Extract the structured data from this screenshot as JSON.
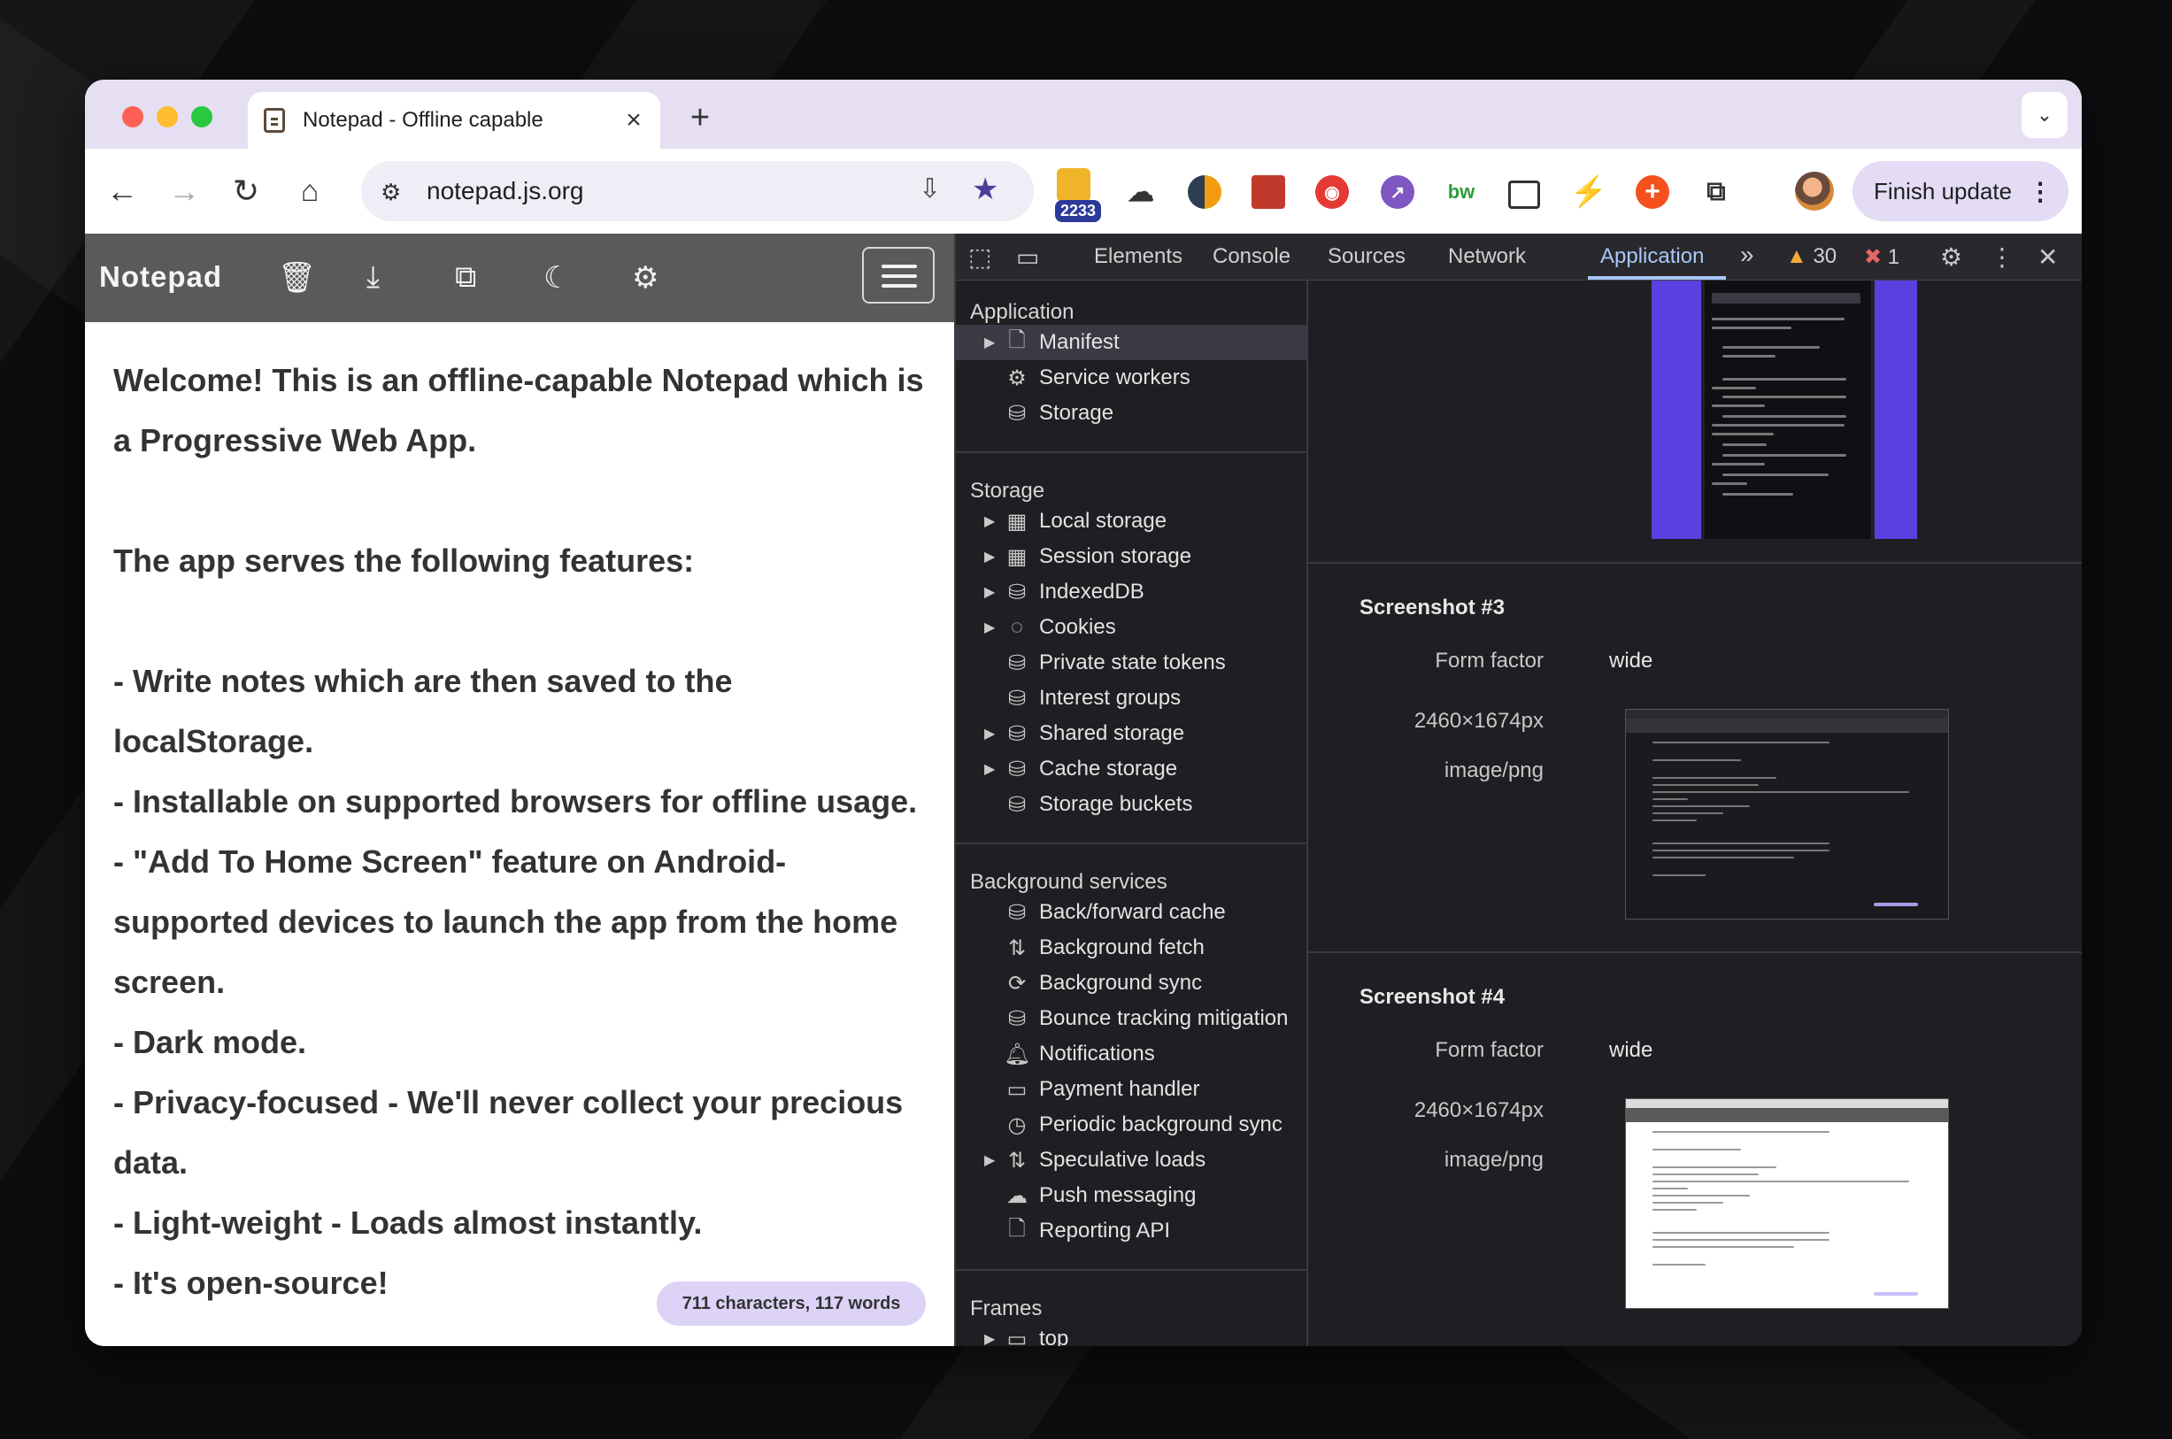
{
  "browser": {
    "tab_title": "Notepad - Offline capable",
    "url": "notepad.js.org",
    "extension_badge": "2233",
    "finish_update_label": "Finish update"
  },
  "app": {
    "brand": "Notepad",
    "note_text": "Welcome! This is an offline-capable Notepad which is a Progressive Web App.\n\nThe app serves the following features:\n\n- Write notes which are then saved to the localStorage.\n- Installable on supported browsers for offline usage.\n- \"Add To Home Screen\" feature on Android-supported devices to launch the app from the home screen.\n- Dark mode.\n- Privacy-focused - We'll never collect your precious data.\n- Light-weight - Loads almost instantly.\n- It's open-source!",
    "counter": "711 characters, 117 words"
  },
  "devtools": {
    "tabs": [
      "Elements",
      "Console",
      "Sources",
      "Network",
      "Application"
    ],
    "active_tab": "Application",
    "warnings": "30",
    "errors": "1",
    "sections": {
      "application": {
        "title": "Application",
        "items": [
          "Manifest",
          "Service workers",
          "Storage"
        ]
      },
      "storage": {
        "title": "Storage",
        "items": [
          "Local storage",
          "Session storage",
          "IndexedDB",
          "Cookies",
          "Private state tokens",
          "Interest groups",
          "Shared storage",
          "Cache storage",
          "Storage buckets"
        ]
      },
      "background": {
        "title": "Background services",
        "items": [
          "Back/forward cache",
          "Background fetch",
          "Background sync",
          "Bounce tracking mitigation",
          "Notifications",
          "Payment handler",
          "Periodic background sync",
          "Speculative loads",
          "Push messaging",
          "Reporting API"
        ]
      },
      "frames": {
        "title": "Frames",
        "items": [
          "top"
        ]
      }
    },
    "screenshots": [
      {
        "title": "Screenshot #3",
        "form_factor_label": "Form factor",
        "form_factor": "wide",
        "size": "2460×1674px",
        "type": "image/png"
      },
      {
        "title": "Screenshot #4",
        "form_factor_label": "Form factor",
        "form_factor": "wide",
        "size": "2460×1674px",
        "type": "image/png"
      }
    ]
  }
}
